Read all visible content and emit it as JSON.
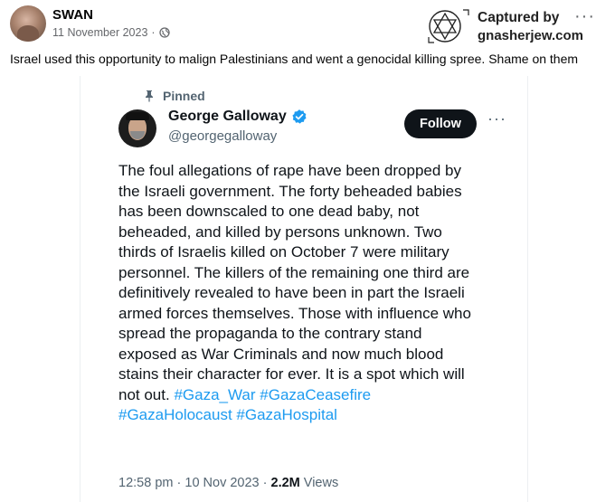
{
  "post": {
    "author": "SWAN",
    "date": "11 November 2023",
    "separator": "·",
    "more_label": "···",
    "text": "Israel used this opportunity to malign Palestinians and went a genocidal killing spree. Shame on them"
  },
  "watermark": {
    "line1": "Captured by",
    "line2": "gnasherjew.com"
  },
  "tweet": {
    "pinned_label": "Pinned",
    "name": "George Galloway",
    "handle": "@georgegalloway",
    "follow_label": "Follow",
    "more_label": "···",
    "body_lines": [
      "The foul allegations of rape have been dropped by",
      "the Israeli government. The forty beheaded babies",
      "has been downscaled to one dead baby, not",
      "beheaded, and killed by persons unknown. Two",
      "thirds of Israelis killed on October 7 were military",
      "personnel. The killers of the remaining one third are",
      "definitively revealed to have been in part the Israeli",
      "armed forces themselves. Those with influence who",
      "spread the propaganda to the contrary stand",
      "exposed as War Criminals and now much blood",
      "stains their character for ever. It is a spot which will"
    ],
    "last_line_text": "not out.",
    "hashtags_line1": [
      "#Gaza_War",
      "#GazaCeasefire"
    ],
    "hashtags_line2": [
      "#GazaHolocaust",
      "#GazaHospital"
    ],
    "time": "12:58 pm",
    "meta_separator": "·",
    "date": "10 Nov 2023",
    "views_count": "2.2M",
    "views_label": "Views"
  },
  "colors": {
    "hashtag": "#1d9bf0",
    "follow_bg": "#0f1419",
    "verified": "#1d9bf0"
  },
  "icons": {
    "globe": "globe-icon",
    "pin": "pin-icon",
    "verified": "verified-badge-icon",
    "watermark": "star-of-david-logo"
  }
}
